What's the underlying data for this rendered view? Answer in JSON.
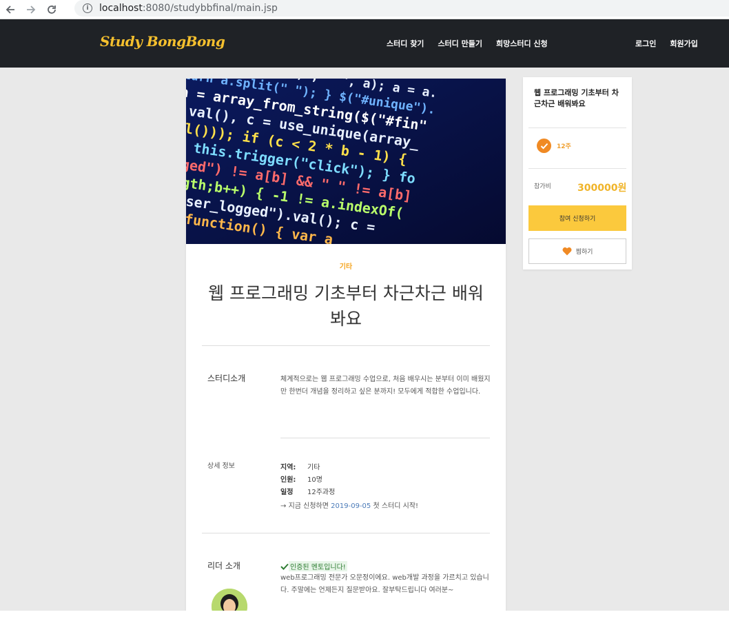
{
  "browser": {
    "url_host": "localhost",
    "url_rest": ":8080/studybbfinal/main.jsp",
    "info_icon": "info-icon"
  },
  "header": {
    "logo": "Study BongBong",
    "nav": [
      "스터디 찾기",
      "스터디 만들기",
      "희망스터디 신청"
    ],
    "auth": [
      "로그인",
      "회원가입"
    ]
  },
  "study": {
    "category": "기타",
    "title": "웹 프로그래밍 기초부터 차근차근 배워봐요",
    "intro_label": "스터디소개",
    "intro_text": "체계적으로는 웹 프로그래밍 수업으로, 처음 배우시는 분부터 이미 배웠지만 한번더 개념을 정리하고 싶은 분까지! 모두에게 적합한 수업입니다.",
    "detail_label": "상세 정보",
    "details": [
      {
        "key": "지역:",
        "value": "기타"
      },
      {
        "key": "인원:",
        "value": "10명"
      },
      {
        "key": "일정",
        "value": "12주과정"
      }
    ],
    "start_prefix": "지금 신청하면",
    "start_date": "2019-09-05",
    "start_suffix": "첫 스터디 시작!",
    "leader_label": "리더 소개",
    "leader_badge": "인증된 멘토입니다!",
    "leader_text": "web프로그래밍 전문가 오문정이에요. web개발 과정을 가르치고 있습니다. 주말에는 언제든지 질문받아요. 잘부탁드립니다 여러분~"
  },
  "side": {
    "title": "웹 프로그래밍 기초부터 차근차근 배워봐요",
    "weeks": "12주",
    "fee_label": "참가비",
    "fee": "300000원",
    "apply_label": "참여 신청하기",
    "wish_label": "찜하기"
  },
  "colors": {
    "header_bg": "#1f2226",
    "logo": "#f5c02e",
    "accent_orange": "#f08a24",
    "apply_yellow": "#fbc93d",
    "page_bg": "#e9e9e9"
  }
}
